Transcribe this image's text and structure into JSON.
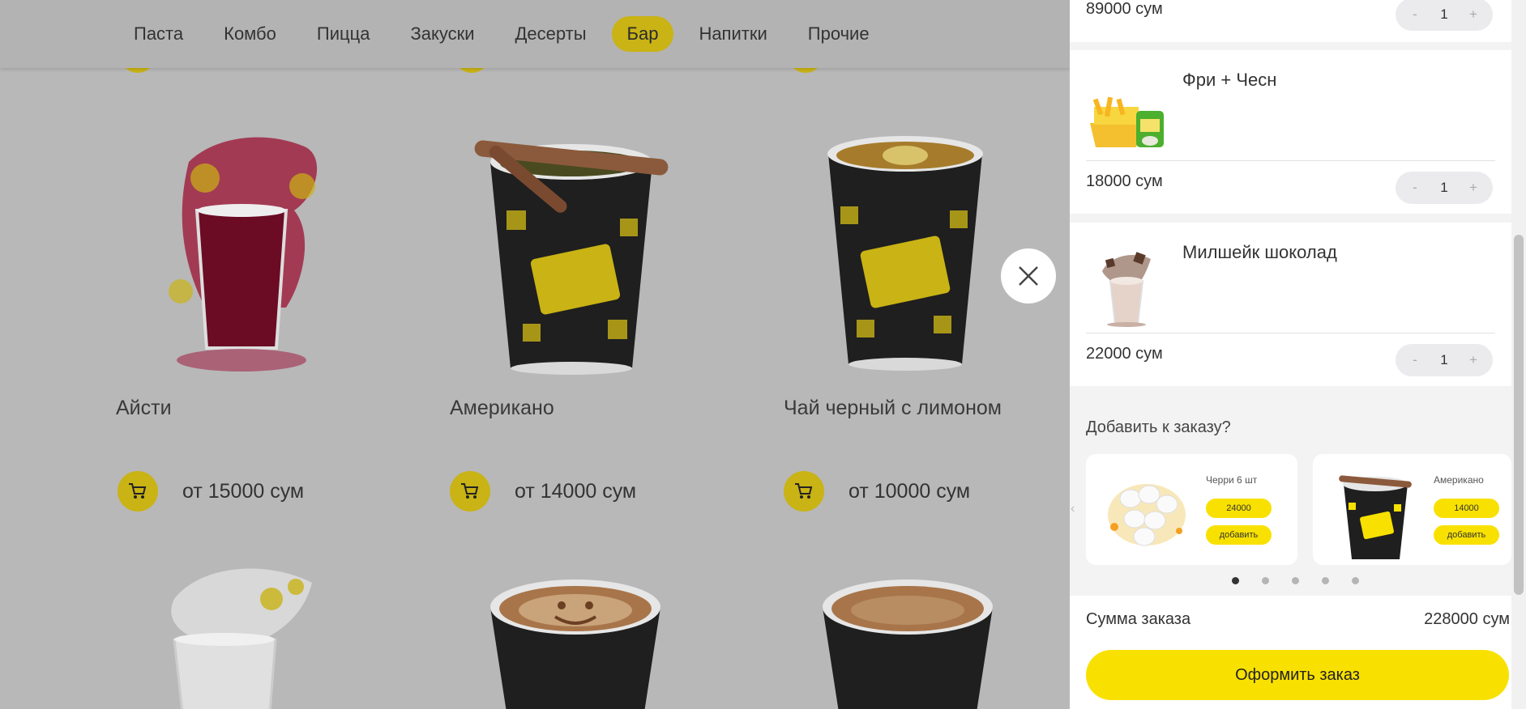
{
  "nav": {
    "items": [
      {
        "label": "Паста"
      },
      {
        "label": "Комбо"
      },
      {
        "label": "Пицца"
      },
      {
        "label": "Закуски"
      },
      {
        "label": "Десерты"
      },
      {
        "label": "Бар",
        "active": true
      },
      {
        "label": "Напитки"
      },
      {
        "label": "Прочие"
      }
    ]
  },
  "products": [
    {
      "name": "Айсти",
      "price": "от 15000 сум",
      "image": "iced-tea-image"
    },
    {
      "name": "Американо",
      "price": "от 14000 сум",
      "image": "americano-cup-image"
    },
    {
      "name": "Чай черный с лимоном",
      "price": "от 10000 сум",
      "image": "black-tea-lemon-cup-image"
    }
  ],
  "cart": {
    "items": [
      {
        "name": "",
        "price": "89000 сум",
        "qty": "1"
      },
      {
        "name": "Фри + Чесн",
        "price": "18000 сум",
        "qty": "1"
      },
      {
        "name": "Милшейк шоколад",
        "price": "22000 сум",
        "qty": "1"
      }
    ],
    "qty_minus": "-",
    "qty_plus": "+",
    "upsell_title": "Добавить к заказу?",
    "upsell": [
      {
        "name": "Черри 6 шт",
        "price": "24000",
        "add": "добавить"
      },
      {
        "name": "Американо",
        "price": "14000",
        "add": "добавить"
      }
    ],
    "sum_label": "Сумма заказа",
    "sum_value": "228000 сум",
    "checkout": "Оформить заказ"
  },
  "colors": {
    "accent": "#f8e100",
    "dim_accent": "#c9b315"
  }
}
